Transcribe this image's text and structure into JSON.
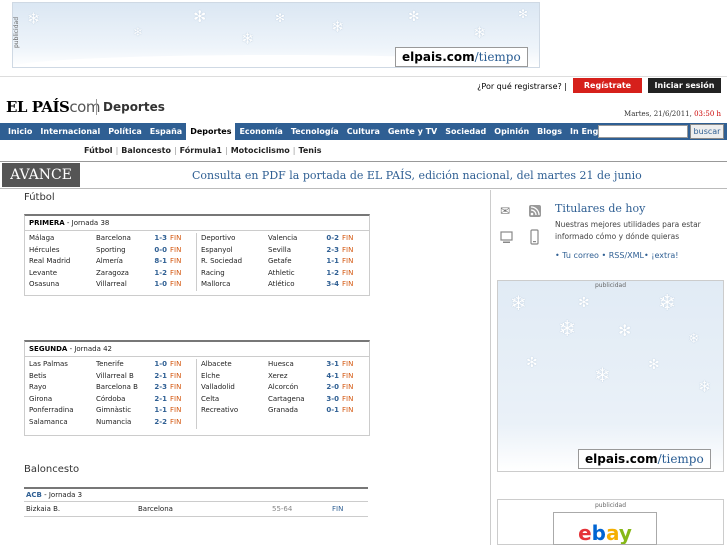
{
  "top_ad": {
    "label": "publicidad",
    "brand": {
      "bold": "elpais.com",
      "thin": "/tiempo"
    }
  },
  "account": {
    "why_register": "¿Por qué registrarse?",
    "register": "Regístrate",
    "login": "Iniciar sesión",
    "separator": "|"
  },
  "header": {
    "logo_main": "EL PAÍS",
    "logo_com": "com",
    "section": "Deportes",
    "date": "Martes, 21/6/2011,",
    "time": "03:50 h"
  },
  "nav": {
    "items": [
      "Inicio",
      "Internacional",
      "Política",
      "España",
      "Deportes",
      "Economía",
      "Tecnología",
      "Cultura",
      "Gente y TV",
      "Sociedad",
      "Opinión",
      "Blogs",
      "In English"
    ],
    "active_index": 4,
    "search_button": "buscar",
    "search_value": ""
  },
  "sub_nav": {
    "items": [
      "Fútbol",
      "Baloncesto",
      "Fórmula1",
      "Motociclismo",
      "Tenis"
    ],
    "separator": "|"
  },
  "avance": {
    "badge": "AVANCE",
    "link": "Consulta en PDF la portada de EL PAÍS, edición nacional, del martes 21 de junio"
  },
  "futbol": {
    "heading": "Fútbol",
    "primera": {
      "league": "PRIMERA",
      "jornada": " - Jornada 38",
      "left": [
        {
          "home": "Málaga",
          "away": "Barcelona",
          "score": "1-3",
          "status": "FIN"
        },
        {
          "home": "Hércules",
          "away": "Sporting",
          "score": "0-0",
          "status": "FIN"
        },
        {
          "home": "Real Madrid",
          "away": "Almería",
          "score": "8-1",
          "status": "FIN"
        },
        {
          "home": "Levante",
          "away": "Zaragoza",
          "score": "1-2",
          "status": "FIN"
        },
        {
          "home": "Osasuna",
          "away": "Villarreal",
          "score": "1-0",
          "status": "FIN"
        }
      ],
      "right": [
        {
          "home": "Deportivo",
          "away": "Valencia",
          "score": "0-2",
          "status": "FIN"
        },
        {
          "home": "Espanyol",
          "away": "Sevilla",
          "score": "2-3",
          "status": "FIN"
        },
        {
          "home": "R. Sociedad",
          "away": "Getafe",
          "score": "1-1",
          "status": "FIN"
        },
        {
          "home": "Racing",
          "away": "Athletic",
          "score": "1-2",
          "status": "FIN"
        },
        {
          "home": "Mallorca",
          "away": "Atlético",
          "score": "3-4",
          "status": "FIN"
        }
      ]
    },
    "segunda": {
      "league": "SEGUNDA",
      "jornada": " - Jornada 42",
      "left": [
        {
          "home": "Las Palmas",
          "away": "Tenerife",
          "score": "1-0",
          "status": "FIN"
        },
        {
          "home": "Betis",
          "away": "Villarreal B",
          "score": "2-1",
          "status": "FIN"
        },
        {
          "home": "Rayo",
          "away": "Barcelona B",
          "score": "2-3",
          "status": "FIN"
        },
        {
          "home": "Girona",
          "away": "Córdoba",
          "score": "2-1",
          "status": "FIN"
        },
        {
          "home": "Ponferradina",
          "away": "Gimnàstic",
          "score": "1-1",
          "status": "FIN"
        },
        {
          "home": "Salamanca",
          "away": "Numancia",
          "score": "2-2",
          "status": "FIN"
        }
      ],
      "right": [
        {
          "home": "Albacete",
          "away": "Huesca",
          "score": "3-1",
          "status": "FIN"
        },
        {
          "home": "Elche",
          "away": "Xerez",
          "score": "4-1",
          "status": "FIN"
        },
        {
          "home": "Valladolid",
          "away": "Alcorcón",
          "score": "2-0",
          "status": "FIN"
        },
        {
          "home": "Celta",
          "away": "Cartagena",
          "score": "3-0",
          "status": "FIN"
        },
        {
          "home": "Recreativo",
          "away": "Granada",
          "score": "0-1",
          "status": "FIN"
        }
      ]
    }
  },
  "baloncesto": {
    "heading": "Baloncesto",
    "league": "ACB",
    "jornada": " - Jornada 3",
    "row": {
      "home": "Bizkaia B.",
      "away": "Barcelona",
      "score": "55-64",
      "status": "FIN"
    }
  },
  "sidebar": {
    "title": "Titulares de hoy",
    "desc": "Nuestras mejores utilidades para estar informado cómo y dónde quieras",
    "links": "• Tu correo • RSS/XML• ¡extra!",
    "ad_label": "publicidad",
    "ad_brand": {
      "bold": "elpais.com",
      "thin": "/tiempo"
    },
    "ad2_label": "publicidad",
    "ebay": "ebay"
  },
  "colors": {
    "nav_blue": "#2f5f93",
    "register_red": "#d6201b",
    "fin_orange": "#d4570f"
  }
}
